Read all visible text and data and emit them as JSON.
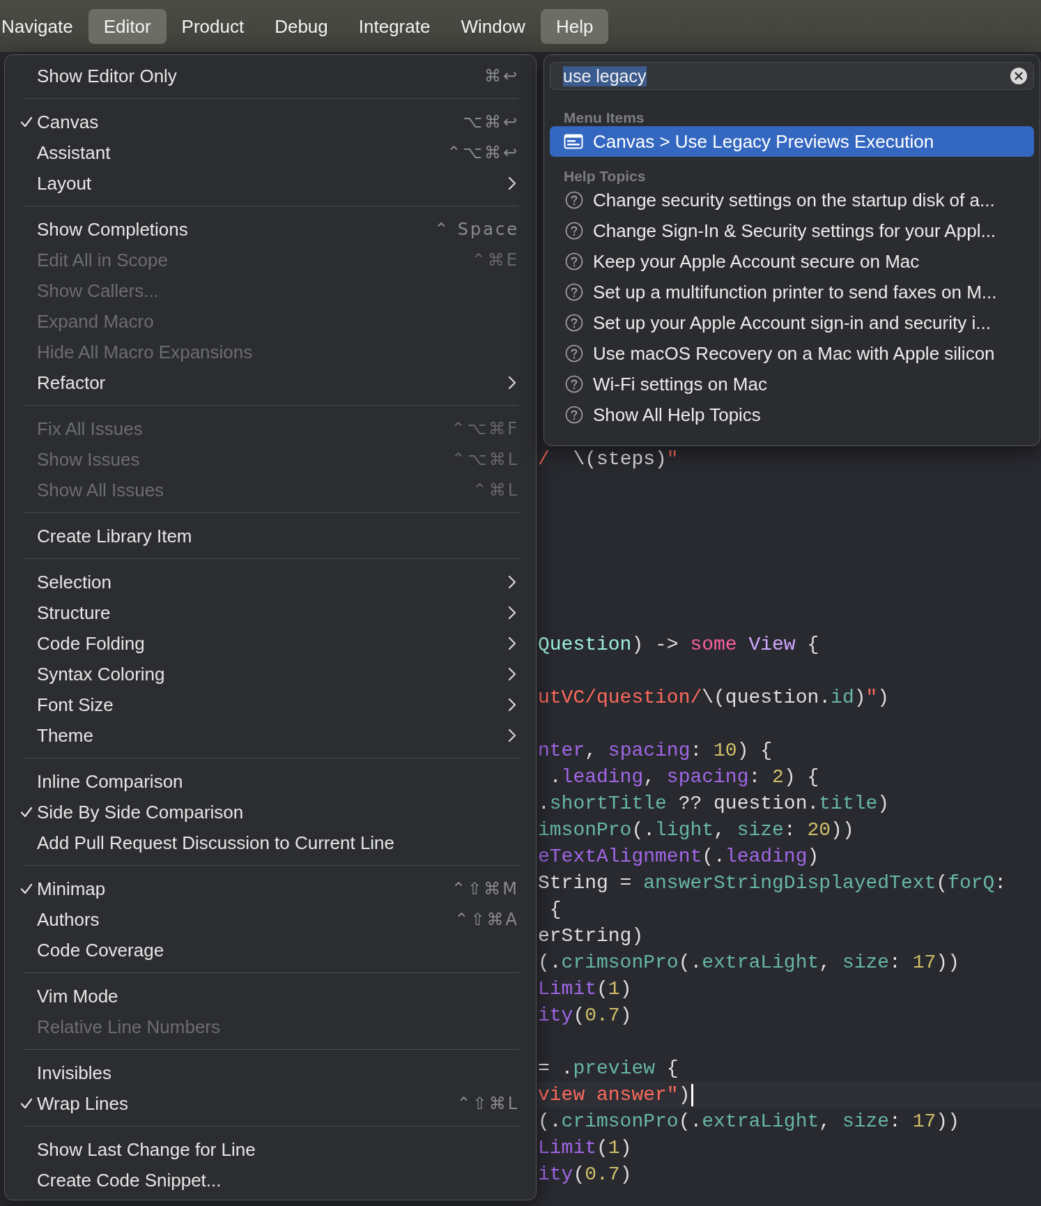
{
  "menu_bar": {
    "items": [
      {
        "label": "Navigate",
        "selected": false
      },
      {
        "label": "Editor",
        "selected": true
      },
      {
        "label": "Product",
        "selected": false
      },
      {
        "label": "Debug",
        "selected": false
      },
      {
        "label": "Integrate",
        "selected": false
      },
      {
        "label": "Window",
        "selected": false
      },
      {
        "label": "Help",
        "selected": true
      }
    ]
  },
  "editor_menu": {
    "items": [
      {
        "kind": "item",
        "label": "Show Editor Only",
        "shortcut": "⌘↩",
        "checked": false,
        "disabled": false,
        "submenu": false
      },
      {
        "kind": "separator"
      },
      {
        "kind": "item",
        "label": "Canvas",
        "shortcut": "⌥⌘↩",
        "checked": true,
        "disabled": false,
        "submenu": false
      },
      {
        "kind": "item",
        "label": "Assistant",
        "shortcut": "⌃⌥⌘↩",
        "checked": false,
        "disabled": false,
        "submenu": false
      },
      {
        "kind": "item",
        "label": "Layout",
        "checked": false,
        "disabled": false,
        "submenu": true
      },
      {
        "kind": "separator"
      },
      {
        "kind": "item",
        "label": "Show Completions",
        "shortcut": "⌃ Space",
        "checked": false,
        "disabled": false,
        "submenu": false
      },
      {
        "kind": "item",
        "label": "Edit All in Scope",
        "shortcut": "⌃⌘E",
        "checked": false,
        "disabled": true,
        "submenu": false
      },
      {
        "kind": "item",
        "label": "Show Callers...",
        "checked": false,
        "disabled": true,
        "submenu": false
      },
      {
        "kind": "item",
        "label": "Expand Macro",
        "checked": false,
        "disabled": true,
        "submenu": false
      },
      {
        "kind": "item",
        "label": "Hide All Macro Expansions",
        "checked": false,
        "disabled": true,
        "submenu": false
      },
      {
        "kind": "item",
        "label": "Refactor",
        "checked": false,
        "disabled": false,
        "submenu": true
      },
      {
        "kind": "separator"
      },
      {
        "kind": "item",
        "label": "Fix All Issues",
        "shortcut": "⌃⌥⌘F",
        "checked": false,
        "disabled": true,
        "submenu": false
      },
      {
        "kind": "item",
        "label": "Show Issues",
        "shortcut": "⌃⌥⌘L",
        "checked": false,
        "disabled": true,
        "submenu": false
      },
      {
        "kind": "item",
        "label": "Show All Issues",
        "shortcut": "⌃⌘L",
        "checked": false,
        "disabled": true,
        "submenu": false
      },
      {
        "kind": "separator"
      },
      {
        "kind": "item",
        "label": "Create Library Item",
        "checked": false,
        "disabled": false,
        "submenu": false
      },
      {
        "kind": "separator"
      },
      {
        "kind": "item",
        "label": "Selection",
        "checked": false,
        "disabled": false,
        "submenu": true
      },
      {
        "kind": "item",
        "label": "Structure",
        "checked": false,
        "disabled": false,
        "submenu": true
      },
      {
        "kind": "item",
        "label": "Code Folding",
        "checked": false,
        "disabled": false,
        "submenu": true
      },
      {
        "kind": "item",
        "label": "Syntax Coloring",
        "checked": false,
        "disabled": false,
        "submenu": true
      },
      {
        "kind": "item",
        "label": "Font Size",
        "checked": false,
        "disabled": false,
        "submenu": true
      },
      {
        "kind": "item",
        "label": "Theme",
        "checked": false,
        "disabled": false,
        "submenu": true
      },
      {
        "kind": "separator"
      },
      {
        "kind": "item",
        "label": "Inline Comparison",
        "checked": false,
        "disabled": false,
        "submenu": false
      },
      {
        "kind": "item",
        "label": "Side By Side Comparison",
        "checked": true,
        "disabled": false,
        "submenu": false
      },
      {
        "kind": "item",
        "label": "Add Pull Request Discussion to Current Line",
        "checked": false,
        "disabled": false,
        "submenu": false
      },
      {
        "kind": "separator"
      },
      {
        "kind": "item",
        "label": "Minimap",
        "shortcut": "⌃⇧⌘M",
        "checked": true,
        "disabled": false,
        "submenu": false
      },
      {
        "kind": "item",
        "label": "Authors",
        "shortcut": "⌃⇧⌘A",
        "checked": false,
        "disabled": false,
        "submenu": false
      },
      {
        "kind": "item",
        "label": "Code Coverage",
        "checked": false,
        "disabled": false,
        "submenu": false
      },
      {
        "kind": "separator"
      },
      {
        "kind": "item",
        "label": "Vim Mode",
        "checked": false,
        "disabled": false,
        "submenu": false
      },
      {
        "kind": "item",
        "label": "Relative Line Numbers",
        "checked": false,
        "disabled": true,
        "submenu": false
      },
      {
        "kind": "separator"
      },
      {
        "kind": "item",
        "label": "Invisibles",
        "checked": false,
        "disabled": false,
        "submenu": false
      },
      {
        "kind": "item",
        "label": "Wrap Lines",
        "shortcut": "⌃⇧⌘L",
        "checked": true,
        "disabled": false,
        "submenu": false
      },
      {
        "kind": "separator"
      },
      {
        "kind": "item",
        "label": "Show Last Change for Line",
        "checked": false,
        "disabled": false,
        "submenu": false
      },
      {
        "kind": "item",
        "label": "Create Code Snippet...",
        "checked": false,
        "disabled": false,
        "submenu": false
      }
    ]
  },
  "help_menu": {
    "search": {
      "value": "use legacy",
      "text_selected": true
    },
    "sections": [
      {
        "heading": "Menu Items",
        "results": [
          {
            "kind": "menu_item",
            "label": "Canvas > Use Legacy Previews Execution",
            "selected": true
          }
        ]
      },
      {
        "heading": "Help Topics",
        "results": [
          {
            "kind": "topic",
            "label": "Change security settings on the startup disk of a...",
            "selected": false
          },
          {
            "kind": "topic",
            "label": "Change Sign-In & Security settings for your Appl...",
            "selected": false
          },
          {
            "kind": "topic",
            "label": "Keep your Apple Account secure on Mac",
            "selected": false
          },
          {
            "kind": "topic",
            "label": "Set up a multifunction printer to send faxes on M...",
            "selected": false
          },
          {
            "kind": "topic",
            "label": "Set up your Apple Account sign-in and security i...",
            "selected": false
          },
          {
            "kind": "topic",
            "label": "Use macOS Recovery on a Mac with Apple silicon",
            "selected": false
          },
          {
            "kind": "topic",
            "label": "Wi-Fi settings on Mac",
            "selected": false
          },
          {
            "kind": "topic",
            "label": "Show All Help Topics",
            "selected": false
          }
        ]
      }
    ]
  },
  "code_editor": {
    "lines": [
      {
        "kind": "code",
        "current": false,
        "tokens": [
          {
            "kind": "string",
            "text": "/"
          },
          {
            "kind": "plain",
            "text": "  \\(steps)"
          },
          {
            "kind": "string",
            "text": "\""
          }
        ]
      },
      {
        "kind": "blank"
      },
      {
        "kind": "blank"
      },
      {
        "kind": "blank"
      },
      {
        "kind": "blank"
      },
      {
        "kind": "blank"
      },
      {
        "kind": "blank"
      },
      {
        "kind": "code",
        "current": false,
        "tokens": [
          {
            "kind": "type",
            "text": "Question"
          },
          {
            "kind": "plain",
            "text": ") -> "
          },
          {
            "kind": "keyword",
            "text": "some"
          },
          {
            "kind": "systype",
            "text": " View"
          },
          {
            "kind": "plain",
            "text": " {"
          }
        ]
      },
      {
        "kind": "blank"
      },
      {
        "kind": "code",
        "current": false,
        "tokens": [
          {
            "kind": "string",
            "text": "utVC/question/"
          },
          {
            "kind": "plain",
            "text": "\\(question."
          },
          {
            "kind": "member",
            "text": "id"
          },
          {
            "kind": "plain",
            "text": ")"
          },
          {
            "kind": "string",
            "text": "\""
          },
          {
            "kind": "plain",
            "text": ")"
          }
        ]
      },
      {
        "kind": "blank"
      },
      {
        "kind": "code",
        "current": false,
        "tokens": [
          {
            "kind": "param",
            "text": "nter"
          },
          {
            "kind": "plain",
            "text": ", "
          },
          {
            "kind": "param",
            "text": "spacing"
          },
          {
            "kind": "plain",
            "text": ": "
          },
          {
            "kind": "number",
            "text": "10"
          },
          {
            "kind": "plain",
            "text": ") {"
          }
        ]
      },
      {
        "kind": "code",
        "current": false,
        "tokens": [
          {
            "kind": "plain",
            "text": " ."
          },
          {
            "kind": "param",
            "text": "leading"
          },
          {
            "kind": "plain",
            "text": ", "
          },
          {
            "kind": "param",
            "text": "spacing"
          },
          {
            "kind": "plain",
            "text": ": "
          },
          {
            "kind": "number",
            "text": "2"
          },
          {
            "kind": "plain",
            "text": ") {"
          }
        ]
      },
      {
        "kind": "code",
        "current": false,
        "tokens": [
          {
            "kind": "plain",
            "text": "."
          },
          {
            "kind": "member",
            "text": "shortTitle"
          },
          {
            "kind": "plain",
            "text": " ?? question."
          },
          {
            "kind": "member",
            "text": "title"
          },
          {
            "kind": "plain",
            "text": ")"
          }
        ]
      },
      {
        "kind": "code",
        "current": false,
        "tokens": [
          {
            "kind": "member",
            "text": "imsonPro"
          },
          {
            "kind": "plain",
            "text": "(."
          },
          {
            "kind": "member",
            "text": "light"
          },
          {
            "kind": "plain",
            "text": ", "
          },
          {
            "kind": "member",
            "text": "size"
          },
          {
            "kind": "plain",
            "text": ": "
          },
          {
            "kind": "number",
            "text": "20"
          },
          {
            "kind": "plain",
            "text": "))"
          }
        ]
      },
      {
        "kind": "code",
        "current": false,
        "tokens": [
          {
            "kind": "param",
            "text": "eTextAlignment"
          },
          {
            "kind": "plain",
            "text": "(."
          },
          {
            "kind": "param",
            "text": "leading"
          },
          {
            "kind": "plain",
            "text": ")"
          }
        ]
      },
      {
        "kind": "code",
        "current": false,
        "tokens": [
          {
            "kind": "plain",
            "text": "String = "
          },
          {
            "kind": "member",
            "text": "answerStringDisplayedText"
          },
          {
            "kind": "plain",
            "text": "("
          },
          {
            "kind": "member",
            "text": "forQ"
          },
          {
            "kind": "plain",
            "text": ":"
          }
        ]
      },
      {
        "kind": "code",
        "current": false,
        "tokens": [
          {
            "kind": "plain",
            "text": " {"
          }
        ]
      },
      {
        "kind": "code",
        "current": false,
        "tokens": [
          {
            "kind": "plain",
            "text": "erString)"
          }
        ]
      },
      {
        "kind": "code",
        "current": false,
        "tokens": [
          {
            "kind": "plain",
            "text": "(."
          },
          {
            "kind": "member",
            "text": "crimsonPro"
          },
          {
            "kind": "plain",
            "text": "(."
          },
          {
            "kind": "member",
            "text": "extraLight"
          },
          {
            "kind": "plain",
            "text": ", "
          },
          {
            "kind": "member",
            "text": "size"
          },
          {
            "kind": "plain",
            "text": ": "
          },
          {
            "kind": "number",
            "text": "17"
          },
          {
            "kind": "plain",
            "text": "))"
          }
        ]
      },
      {
        "kind": "code",
        "current": false,
        "tokens": [
          {
            "kind": "param",
            "text": "Limit"
          },
          {
            "kind": "plain",
            "text": "("
          },
          {
            "kind": "number",
            "text": "1"
          },
          {
            "kind": "plain",
            "text": ")"
          }
        ]
      },
      {
        "kind": "code",
        "current": false,
        "tokens": [
          {
            "kind": "param",
            "text": "ity"
          },
          {
            "kind": "plain",
            "text": "("
          },
          {
            "kind": "number",
            "text": "0.7"
          },
          {
            "kind": "plain",
            "text": ")"
          }
        ]
      },
      {
        "kind": "blank"
      },
      {
        "kind": "code",
        "current": false,
        "tokens": [
          {
            "kind": "plain",
            "text": "= ."
          },
          {
            "kind": "member",
            "text": "preview"
          },
          {
            "kind": "plain",
            "text": " {"
          }
        ]
      },
      {
        "kind": "code",
        "current": true,
        "tokens": [
          {
            "kind": "string",
            "text": "view answer\""
          },
          {
            "kind": "plain",
            "text": ")"
          }
        ]
      },
      {
        "kind": "code",
        "current": false,
        "tokens": [
          {
            "kind": "plain",
            "text": "(."
          },
          {
            "kind": "member",
            "text": "crimsonPro"
          },
          {
            "kind": "plain",
            "text": "(."
          },
          {
            "kind": "member",
            "text": "extraLight"
          },
          {
            "kind": "plain",
            "text": ", "
          },
          {
            "kind": "member",
            "text": "size"
          },
          {
            "kind": "plain",
            "text": ": "
          },
          {
            "kind": "number",
            "text": "17"
          },
          {
            "kind": "plain",
            "text": "))"
          }
        ]
      },
      {
        "kind": "code",
        "current": false,
        "tokens": [
          {
            "kind": "param",
            "text": "Limit"
          },
          {
            "kind": "plain",
            "text": "("
          },
          {
            "kind": "number",
            "text": "1"
          },
          {
            "kind": "plain",
            "text": ")"
          }
        ]
      },
      {
        "kind": "code",
        "current": false,
        "tokens": [
          {
            "kind": "param",
            "text": "ity"
          },
          {
            "kind": "plain",
            "text": "("
          },
          {
            "kind": "number",
            "text": "0.7"
          },
          {
            "kind": "plain",
            "text": ")"
          }
        ]
      }
    ]
  }
}
